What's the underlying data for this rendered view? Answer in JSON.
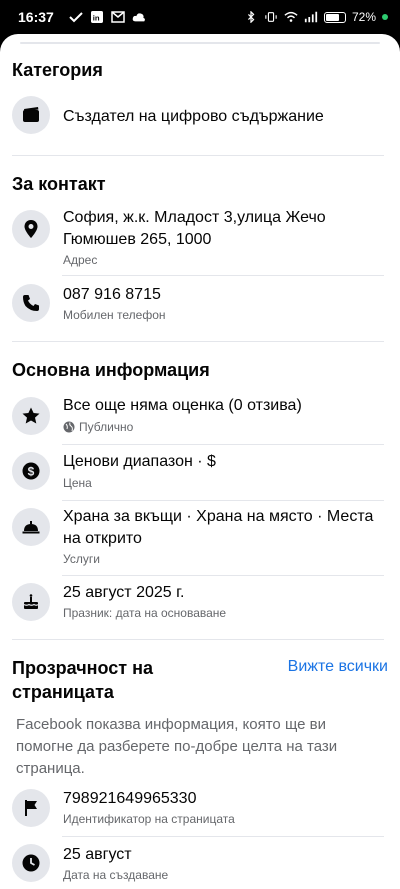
{
  "status_bar": {
    "time": "16:37",
    "battery": "72%",
    "battery_level": 0.72,
    "icons_left": [
      "check-icon",
      "linkedin-icon",
      "mail-icon",
      "cloud-icon"
    ],
    "icons_right": [
      "bluetooth-icon",
      "vibrate-icon",
      "wifi-icon",
      "signal-icon",
      "battery-icon"
    ]
  },
  "category": {
    "title": "Категория",
    "value": "Създател на цифрово съдържание",
    "icon": "clapperboard-icon"
  },
  "contact": {
    "title": "За контакт",
    "address": "София, ж.к. Младост 3,улица Жечо Гюмюшев 265, 1000",
    "address_label": "Адрес",
    "phone": "087 916 8715",
    "phone_label": "Мобилен телефон"
  },
  "basic_info": {
    "title": "Основна информация",
    "rating": "Все още няма оценка (0 отзива)",
    "rating_label": "Публично",
    "price": "Ценови диапазон · $",
    "price_label": "Цена",
    "services": "Храна за вкъщи · Храна на място · Места на открито",
    "services_label": "Услуги",
    "founded": "25 август 2025 г.",
    "founded_label": "Празник: дата на основаване"
  },
  "transparency": {
    "title": "Прозрачност на страницата",
    "see_all": "Вижте всички",
    "description": "Facebook показва информация, която ще ви помогне да разберете по-добре целта на тази страница.",
    "page_id": "798921649965330",
    "page_id_label": "Идентификатор на страницата",
    "created": "25 август",
    "created_label": "Дата на създаване"
  },
  "colors": {
    "link": "#1b74e4",
    "secondary_text": "#65676b",
    "icon_bg": "#e4e6eb"
  }
}
